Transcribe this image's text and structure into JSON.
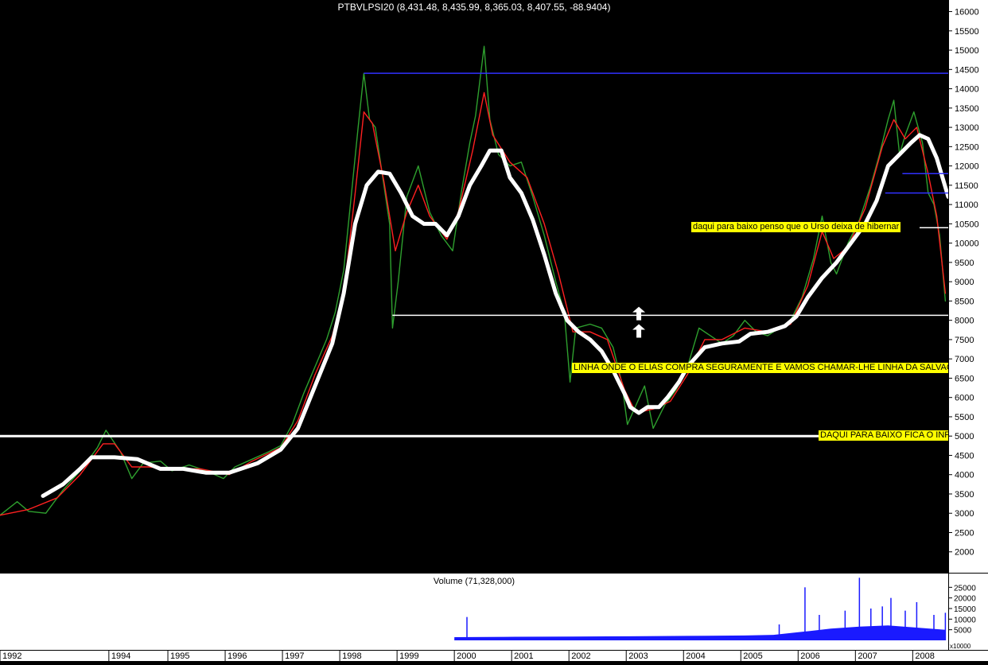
{
  "chart_data": {
    "type": "line",
    "title": "PTBVLPSI20 (8,431.48, 8,435.99, 8,365.03, 8,407.55, -88.9404)",
    "x_range": [
      1992.0,
      2008.55
    ],
    "ylim": [
      1500,
      16300
    ],
    "y_ticks": [
      2000,
      2500,
      3000,
      3500,
      4000,
      4500,
      5000,
      5500,
      6000,
      6500,
      7000,
      7500,
      8000,
      8500,
      9000,
      9500,
      10000,
      10500,
      11000,
      11500,
      12000,
      12500,
      13000,
      13500,
      14000,
      14500,
      15000,
      15500,
      16000
    ],
    "x_tick_labels": [
      {
        "label": "1992",
        "x": 1992.0
      },
      {
        "label": "1994",
        "x": 1993.9
      },
      {
        "label": "1995",
        "x": 1994.93
      },
      {
        "label": "1996",
        "x": 1995.93
      },
      {
        "label": "1997",
        "x": 1996.93
      },
      {
        "label": "1998",
        "x": 1997.93
      },
      {
        "label": "1999",
        "x": 1998.93
      },
      {
        "label": "2000",
        "x": 1999.93
      },
      {
        "label": "2001",
        "x": 2000.93
      },
      {
        "label": "2002",
        "x": 2001.93
      },
      {
        "label": "2003",
        "x": 2002.93
      },
      {
        "label": "2004",
        "x": 2003.93
      },
      {
        "label": "2005",
        "x": 2004.93
      },
      {
        "label": "2006",
        "x": 2005.93
      },
      {
        "label": "2007",
        "x": 2006.93
      },
      {
        "label": "2008",
        "x": 2007.93
      }
    ],
    "series": [
      {
        "color": "#2ea02e",
        "points": [
          [
            1992.0,
            2950
          ],
          [
            1992.3,
            3300
          ],
          [
            1992.5,
            3050
          ],
          [
            1992.8,
            3000
          ],
          [
            1993.1,
            3600
          ],
          [
            1993.4,
            4100
          ],
          [
            1993.7,
            4700
          ],
          [
            1993.85,
            5150
          ],
          [
            1994.1,
            4600
          ],
          [
            1994.3,
            3900
          ],
          [
            1994.5,
            4300
          ],
          [
            1994.8,
            4350
          ],
          [
            1995.0,
            4100
          ],
          [
            1995.3,
            4250
          ],
          [
            1995.6,
            4100
          ],
          [
            1995.9,
            3900
          ],
          [
            1996.1,
            4200
          ],
          [
            1996.4,
            4400
          ],
          [
            1996.7,
            4600
          ],
          [
            1996.9,
            4750
          ],
          [
            1997.1,
            5300
          ],
          [
            1997.3,
            6100
          ],
          [
            1997.5,
            6800
          ],
          [
            1997.7,
            7500
          ],
          [
            1997.85,
            8200
          ],
          [
            1998.0,
            9300
          ],
          [
            1998.15,
            11500
          ],
          [
            1998.25,
            13000
          ],
          [
            1998.35,
            14400
          ],
          [
            1998.45,
            13200
          ],
          [
            1998.55,
            13000
          ],
          [
            1998.7,
            11500
          ],
          [
            1998.8,
            10500
          ],
          [
            1998.85,
            7800
          ],
          [
            1998.95,
            9000
          ],
          [
            1999.1,
            11200
          ],
          [
            1999.3,
            12000
          ],
          [
            1999.5,
            10800
          ],
          [
            1999.7,
            10200
          ],
          [
            1999.9,
            9800
          ],
          [
            2000.05,
            11300
          ],
          [
            2000.2,
            12600
          ],
          [
            2000.3,
            13300
          ],
          [
            2000.4,
            14500
          ],
          [
            2000.45,
            15100
          ],
          [
            2000.55,
            13200
          ],
          [
            2000.7,
            12300
          ],
          [
            2000.9,
            12000
          ],
          [
            2001.1,
            12100
          ],
          [
            2001.3,
            11200
          ],
          [
            2001.5,
            10200
          ],
          [
            2001.7,
            9000
          ],
          [
            2001.85,
            8200
          ],
          [
            2001.95,
            6400
          ],
          [
            2002.05,
            7800
          ],
          [
            2002.3,
            7900
          ],
          [
            2002.5,
            7800
          ],
          [
            2002.7,
            7300
          ],
          [
            2002.85,
            6400
          ],
          [
            2002.95,
            5300
          ],
          [
            2003.1,
            5800
          ],
          [
            2003.25,
            6300
          ],
          [
            2003.4,
            5200
          ],
          [
            2003.6,
            5800
          ],
          [
            2003.8,
            6200
          ],
          [
            2004.0,
            6800
          ],
          [
            2004.2,
            7800
          ],
          [
            2004.4,
            7600
          ],
          [
            2004.6,
            7400
          ],
          [
            2004.8,
            7600
          ],
          [
            2005.0,
            8000
          ],
          [
            2005.2,
            7700
          ],
          [
            2005.4,
            7600
          ],
          [
            2005.6,
            7800
          ],
          [
            2005.8,
            8000
          ],
          [
            2006.0,
            8600
          ],
          [
            2006.2,
            9600
          ],
          [
            2006.35,
            10700
          ],
          [
            2006.5,
            9500
          ],
          [
            2006.6,
            9200
          ],
          [
            2006.8,
            10000
          ],
          [
            2007.0,
            10600
          ],
          [
            2007.2,
            11500
          ],
          [
            2007.35,
            12300
          ],
          [
            2007.5,
            13200
          ],
          [
            2007.6,
            13700
          ],
          [
            2007.7,
            12300
          ],
          [
            2007.8,
            12800
          ],
          [
            2007.95,
            13400
          ],
          [
            2008.1,
            12600
          ],
          [
            2008.2,
            11300
          ],
          [
            2008.3,
            11000
          ],
          [
            2008.4,
            10200
          ],
          [
            2008.5,
            8500
          ]
        ]
      },
      {
        "color": "#ff2020",
        "points": [
          [
            1992.0,
            2950
          ],
          [
            1992.5,
            3100
          ],
          [
            1993.0,
            3400
          ],
          [
            1993.4,
            4000
          ],
          [
            1993.8,
            4800
          ],
          [
            1994.0,
            4800
          ],
          [
            1994.3,
            4200
          ],
          [
            1994.6,
            4200
          ],
          [
            1995.0,
            4150
          ],
          [
            1995.5,
            4150
          ],
          [
            1996.0,
            4000
          ],
          [
            1996.4,
            4350
          ],
          [
            1996.9,
            4700
          ],
          [
            1997.2,
            5400
          ],
          [
            1997.5,
            6600
          ],
          [
            1997.8,
            7600
          ],
          [
            1998.0,
            8700
          ],
          [
            1998.2,
            11300
          ],
          [
            1998.35,
            13400
          ],
          [
            1998.5,
            13100
          ],
          [
            1998.7,
            11600
          ],
          [
            1998.9,
            9800
          ],
          [
            1999.1,
            10800
          ],
          [
            1999.3,
            11500
          ],
          [
            1999.5,
            10700
          ],
          [
            1999.8,
            10100
          ],
          [
            2000.0,
            10800
          ],
          [
            2000.25,
            12400
          ],
          [
            2000.45,
            13900
          ],
          [
            2000.6,
            12800
          ],
          [
            2000.9,
            12100
          ],
          [
            2001.2,
            11700
          ],
          [
            2001.5,
            10500
          ],
          [
            2001.75,
            9200
          ],
          [
            2002.0,
            7700
          ],
          [
            2002.3,
            7700
          ],
          [
            2002.6,
            7500
          ],
          [
            2002.9,
            6200
          ],
          [
            2003.1,
            5600
          ],
          [
            2003.4,
            5700
          ],
          [
            2003.7,
            5900
          ],
          [
            2004.0,
            6600
          ],
          [
            2004.3,
            7500
          ],
          [
            2004.6,
            7500
          ],
          [
            2005.0,
            7800
          ],
          [
            2005.4,
            7700
          ],
          [
            2005.8,
            7900
          ],
          [
            2006.1,
            8900
          ],
          [
            2006.35,
            10300
          ],
          [
            2006.55,
            9600
          ],
          [
            2006.8,
            9900
          ],
          [
            2007.1,
            10900
          ],
          [
            2007.4,
            12500
          ],
          [
            2007.6,
            13200
          ],
          [
            2007.8,
            12700
          ],
          [
            2008.0,
            13000
          ],
          [
            2008.2,
            11800
          ],
          [
            2008.35,
            10700
          ],
          [
            2008.5,
            8700
          ]
        ]
      },
      {
        "color": "#ffffff",
        "points": [
          [
            1992.75,
            3450
          ],
          [
            1993.1,
            3750
          ],
          [
            1993.4,
            4150
          ],
          [
            1993.6,
            4450
          ],
          [
            1994.0,
            4450
          ],
          [
            1994.4,
            4400
          ],
          [
            1994.8,
            4150
          ],
          [
            1995.2,
            4150
          ],
          [
            1995.6,
            4050
          ],
          [
            1996.0,
            4050
          ],
          [
            1996.5,
            4300
          ],
          [
            1996.9,
            4650
          ],
          [
            1997.2,
            5200
          ],
          [
            1997.5,
            6300
          ],
          [
            1997.8,
            7400
          ],
          [
            1998.0,
            8700
          ],
          [
            1998.2,
            10500
          ],
          [
            1998.4,
            11500
          ],
          [
            1998.6,
            11850
          ],
          [
            1998.8,
            11800
          ],
          [
            1999.0,
            11300
          ],
          [
            1999.2,
            10700
          ],
          [
            1999.4,
            10500
          ],
          [
            1999.6,
            10500
          ],
          [
            1999.8,
            10200
          ],
          [
            2000.0,
            10700
          ],
          [
            2000.2,
            11500
          ],
          [
            2000.4,
            12000
          ],
          [
            2000.55,
            12400
          ],
          [
            2000.75,
            12400
          ],
          [
            2000.9,
            11700
          ],
          [
            2001.1,
            11300
          ],
          [
            2001.3,
            10600
          ],
          [
            2001.5,
            9700
          ],
          [
            2001.7,
            8700
          ],
          [
            2001.9,
            8000
          ],
          [
            2002.1,
            7700
          ],
          [
            2002.3,
            7500
          ],
          [
            2002.5,
            7200
          ],
          [
            2002.7,
            6700
          ],
          [
            2002.9,
            6100
          ],
          [
            2003.0,
            5750
          ],
          [
            2003.15,
            5600
          ],
          [
            2003.3,
            5750
          ],
          [
            2003.5,
            5750
          ],
          [
            2003.65,
            6000
          ],
          [
            2003.85,
            6400
          ],
          [
            2004.0,
            6800
          ],
          [
            2004.3,
            7300
          ],
          [
            2004.6,
            7400
          ],
          [
            2004.9,
            7450
          ],
          [
            2005.1,
            7650
          ],
          [
            2005.4,
            7700
          ],
          [
            2005.7,
            7850
          ],
          [
            2005.9,
            8100
          ],
          [
            2006.1,
            8600
          ],
          [
            2006.35,
            9100
          ],
          [
            2006.6,
            9500
          ],
          [
            2006.85,
            10000
          ],
          [
            2007.1,
            10500
          ],
          [
            2007.3,
            11100
          ],
          [
            2007.5,
            12000
          ],
          [
            2007.7,
            12300
          ],
          [
            2007.9,
            12600
          ],
          [
            2008.05,
            12800
          ],
          [
            2008.2,
            12700
          ],
          [
            2008.35,
            12200
          ],
          [
            2008.55,
            11200
          ]
        ]
      }
    ],
    "horizontal_lines": [
      {
        "y": 14400,
        "x_start": 1998.35,
        "x_end": 2008.55,
        "color": "#3030ff"
      },
      {
        "y": 8130,
        "x_start": 1998.85,
        "x_end": 2008.55,
        "color": "#ffffff"
      },
      {
        "y": 5000,
        "x_start": 1992.0,
        "x_end": 2008.55,
        "color": "#ffffff"
      },
      {
        "y": 10400,
        "x_start": 2008.05,
        "x_end": 2008.55,
        "color": "#ffffff"
      },
      {
        "y": 11800,
        "x_start": 2007.75,
        "x_end": 2008.55,
        "color": "#3030ff"
      },
      {
        "y": 11300,
        "x_start": 2007.45,
        "x_end": 2008.55,
        "color": "#3030ff"
      }
    ],
    "arrows": [
      {
        "x": 2003.15,
        "y_from": 7550,
        "y_to": 7900,
        "color": "#ffffff"
      },
      {
        "x": 2003.15,
        "y_from": 8000,
        "y_to": 8350,
        "color": "#ffffff"
      }
    ],
    "annotations": [
      {
        "text": "daqui para baixo penso que o Urso deixa de hibernar",
        "x": 2004.06,
        "y": 10400
      },
      {
        "text": "LINHA ONDE O ELIAS COMPRA SEGURAMENTE E VAMOS CHAMAR-LHE LINHA DA SALVAÇÃO",
        "x": 2001.98,
        "y": 6750
      },
      {
        "text": "DAQUI PARA BAIXO FICA O INFERNO",
        "x": 2006.28,
        "y": 5000
      }
    ],
    "volume": {
      "title": "Volume (71,328,000)",
      "unit_label": "x10000",
      "ylim": [
        0,
        30000
      ],
      "y_ticks": [
        5000,
        10000,
        15000,
        20000,
        25000
      ],
      "color": "#1a1aff",
      "x_start": 1999.93,
      "baseline": [
        [
          1999.93,
          1500
        ],
        [
          2001.0,
          1700
        ],
        [
          2002.0,
          1800
        ],
        [
          2003.0,
          1900
        ],
        [
          2004.0,
          2100
        ],
        [
          2005.0,
          2300
        ],
        [
          2005.5,
          2600
        ],
        [
          2006.0,
          4000
        ],
        [
          2006.5,
          5500
        ],
        [
          2007.0,
          6500
        ],
        [
          2007.5,
          7000
        ],
        [
          2008.0,
          6000
        ],
        [
          2008.5,
          5000
        ]
      ],
      "spikes": [
        [
          2000.15,
          11000
        ],
        [
          2005.6,
          7500
        ],
        [
          2006.05,
          25000
        ],
        [
          2006.3,
          12000
        ],
        [
          2006.75,
          14000
        ],
        [
          2007.0,
          29500
        ],
        [
          2007.2,
          15000
        ],
        [
          2007.4,
          16000
        ],
        [
          2007.55,
          20000
        ],
        [
          2007.8,
          14000
        ],
        [
          2008.0,
          18000
        ],
        [
          2008.3,
          12000
        ],
        [
          2008.5,
          13000
        ]
      ]
    }
  }
}
